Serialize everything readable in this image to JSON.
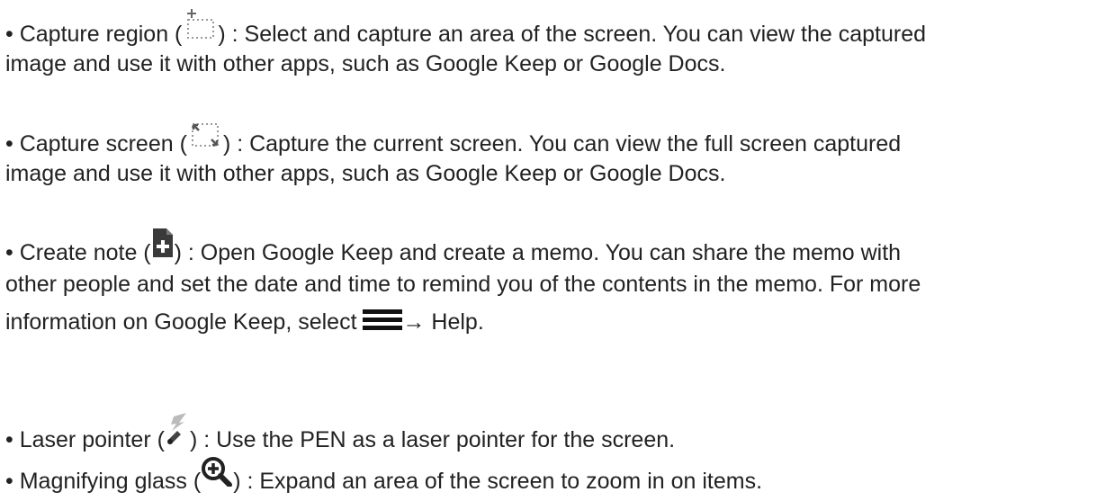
{
  "items": [
    {
      "bullet": "•",
      "title": "Capture region",
      "icon": "capture-region-icon",
      "line1_after": ") : Select and capture an area of the screen. You can view the captured",
      "line2": "image and use it with other apps, such as Google Keep or Google Docs."
    },
    {
      "bullet": "•",
      "title": "Capture screen",
      "icon": "capture-screen-icon",
      "line1_after": ") : Capture the current screen. You can view the full screen captured",
      "line2": "image and use it with other apps, such as Google Keep or Google Docs."
    },
    {
      "bullet": "•",
      "title": "Create note",
      "icon": "create-note-icon",
      "line1_after": ") : Open Google Keep and create a memo. You can share the memo with",
      "line2": "other people and set the date and time to remind you of the contents in the memo. For more",
      "line3_before": "information on Google Keep, select",
      "menu_icon": "menu-icon",
      "arrow": "→",
      "line3_after": "Help."
    },
    {
      "bullet": "•",
      "title": "Laser pointer",
      "icon": "laser-pointer-icon",
      "line1_after": ") : Use the PEN as a laser pointer for the screen."
    },
    {
      "bullet": "•",
      "title": "Magnifying glass",
      "icon": "magnifying-glass-icon",
      "line1_after": ") : Expand an area of the screen to zoom in on items."
    }
  ]
}
